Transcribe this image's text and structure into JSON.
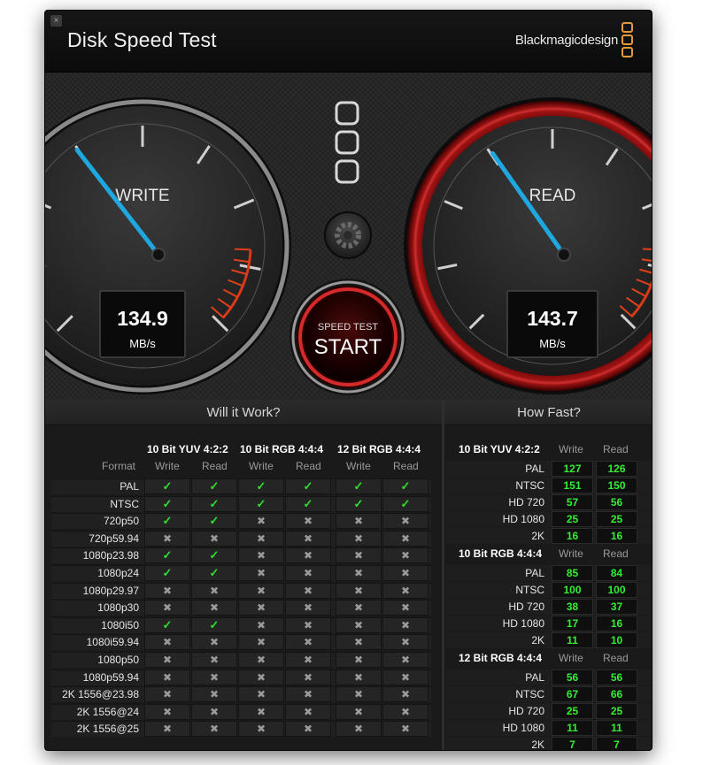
{
  "window": {
    "title": "Disk Speed Test",
    "brand": "Blackmagicdesign",
    "close_glyph": "×"
  },
  "gauges": {
    "write": {
      "label": "WRITE",
      "value": "134.9",
      "unit": "MB/s",
      "needle_fraction": 0.36
    },
    "read": {
      "label": "READ",
      "value": "143.7",
      "unit": "MB/s",
      "needle_fraction": 0.37
    }
  },
  "start_button": {
    "small_label": "SPEED TEST",
    "label": "START"
  },
  "colors": {
    "accent_needle": "#1fa8e0",
    "check": "#2ee02e",
    "fast_value": "#33ee33",
    "read_ring": "#8a1010",
    "brand_logo": "#e49a3a"
  },
  "will_it_work": {
    "title": "Will it Work?",
    "format_header": "Format",
    "groups": [
      "10 Bit YUV 4:2:2",
      "10 Bit RGB 4:4:4",
      "12 Bit RGB 4:4:4"
    ],
    "subcols": [
      "Write",
      "Read",
      "Write",
      "Read",
      "Write",
      "Read"
    ],
    "rows": [
      {
        "format": "PAL",
        "results": [
          true,
          true,
          true,
          true,
          true,
          true
        ]
      },
      {
        "format": "NTSC",
        "results": [
          true,
          true,
          true,
          true,
          true,
          true
        ]
      },
      {
        "format": "720p50",
        "results": [
          true,
          true,
          false,
          false,
          false,
          false
        ]
      },
      {
        "format": "720p59.94",
        "results": [
          false,
          false,
          false,
          false,
          false,
          false
        ]
      },
      {
        "format": "1080p23.98",
        "results": [
          true,
          true,
          false,
          false,
          false,
          false
        ]
      },
      {
        "format": "1080p24",
        "results": [
          true,
          true,
          false,
          false,
          false,
          false
        ]
      },
      {
        "format": "1080p29.97",
        "results": [
          false,
          false,
          false,
          false,
          false,
          false
        ]
      },
      {
        "format": "1080p30",
        "results": [
          false,
          false,
          false,
          false,
          false,
          false
        ]
      },
      {
        "format": "1080i50",
        "results": [
          true,
          true,
          false,
          false,
          false,
          false
        ]
      },
      {
        "format": "1080i59.94",
        "results": [
          false,
          false,
          false,
          false,
          false,
          false
        ]
      },
      {
        "format": "1080p50",
        "results": [
          false,
          false,
          false,
          false,
          false,
          false
        ]
      },
      {
        "format": "1080p59.94",
        "results": [
          false,
          false,
          false,
          false,
          false,
          false
        ]
      },
      {
        "format": "2K 1556@23.98",
        "results": [
          false,
          false,
          false,
          false,
          false,
          false
        ]
      },
      {
        "format": "2K 1556@24",
        "results": [
          false,
          false,
          false,
          false,
          false,
          false
        ]
      },
      {
        "format": "2K 1556@25",
        "results": [
          false,
          false,
          false,
          false,
          false,
          false
        ]
      }
    ],
    "check_glyph": "✓",
    "cross_glyph": "✖"
  },
  "how_fast": {
    "title": "How Fast?",
    "write_header": "Write",
    "read_header": "Read",
    "groups": [
      {
        "name": "10 Bit YUV 4:2:2",
        "rows": [
          {
            "format": "PAL",
            "write": "127",
            "read": "126"
          },
          {
            "format": "NTSC",
            "write": "151",
            "read": "150"
          },
          {
            "format": "HD 720",
            "write": "57",
            "read": "56"
          },
          {
            "format": "HD 1080",
            "write": "25",
            "read": "25"
          },
          {
            "format": "2K",
            "write": "16",
            "read": "16"
          }
        ]
      },
      {
        "name": "10 Bit RGB 4:4:4",
        "rows": [
          {
            "format": "PAL",
            "write": "85",
            "read": "84"
          },
          {
            "format": "NTSC",
            "write": "100",
            "read": "100"
          },
          {
            "format": "HD 720",
            "write": "38",
            "read": "37"
          },
          {
            "format": "HD 1080",
            "write": "17",
            "read": "16"
          },
          {
            "format": "2K",
            "write": "11",
            "read": "10"
          }
        ]
      },
      {
        "name": "12 Bit RGB 4:4:4",
        "rows": [
          {
            "format": "PAL",
            "write": "56",
            "read": "56"
          },
          {
            "format": "NTSC",
            "write": "67",
            "read": "66"
          },
          {
            "format": "HD 720",
            "write": "25",
            "read": "25"
          },
          {
            "format": "HD 1080",
            "write": "11",
            "read": "11"
          },
          {
            "format": "2K",
            "write": "7",
            "read": "7"
          }
        ]
      }
    ]
  }
}
